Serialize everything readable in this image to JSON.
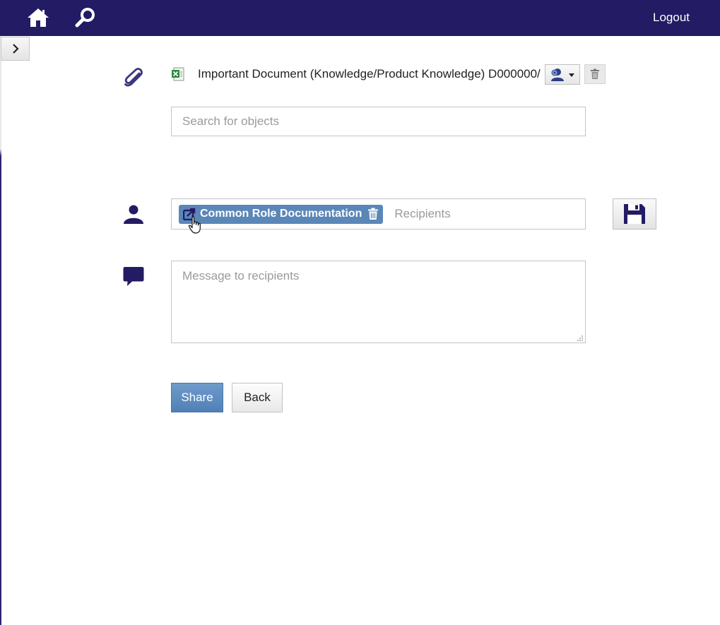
{
  "header": {
    "home_icon": "home-icon",
    "search_icon": "search-icon",
    "logout_label": "Logout",
    "bg_color": "#231b64"
  },
  "sidebar": {
    "toggle_icon": "chevron-right-icon"
  },
  "attachment": {
    "row_icon": "paperclip-icon",
    "file_icon": "excel-file-icon",
    "title": "Important Document (Knowledge/Product Knowledge) D000000/",
    "permissions_icon": "user-gear-dropdown-icon",
    "delete_icon": "trash-icon"
  },
  "search": {
    "placeholder": "Search for objects"
  },
  "recipients": {
    "row_icon": "user-icon",
    "chip_label": "Common Role Documentation",
    "chip_link_icon": "external-link-icon",
    "chip_delete_icon": "trash-icon",
    "placeholder": "Recipients",
    "chip_color": "#5b87b8"
  },
  "save": {
    "icon": "floppy-disk-icon"
  },
  "message": {
    "row_icon": "speech-bubble-icon",
    "placeholder": "Message to recipients"
  },
  "actions": {
    "share_label": "Share",
    "back_label": "Back",
    "share_color": "#5b87b8"
  }
}
